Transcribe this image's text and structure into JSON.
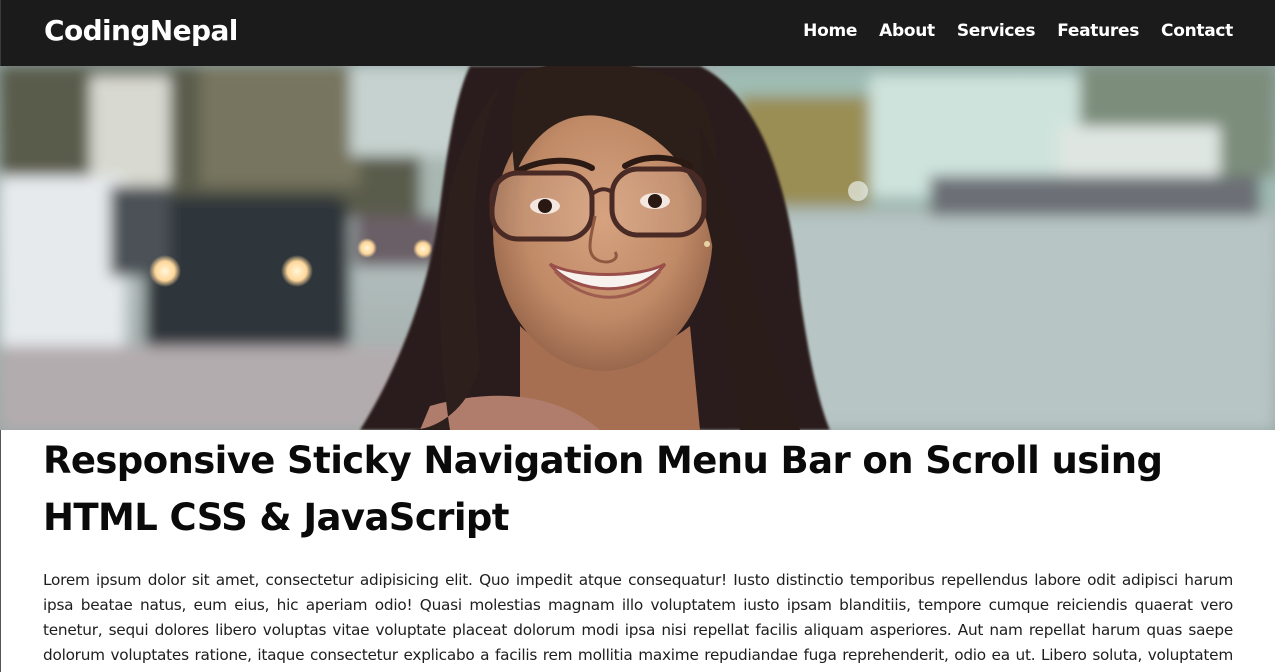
{
  "navbar": {
    "logo": "CodingNepal",
    "links": [
      "Home",
      "About",
      "Services",
      "Features",
      "Contact"
    ]
  },
  "hero": {
    "image": "woman-smiling-glasses-street-photo"
  },
  "article": {
    "title": "Responsive Sticky Navigation Menu Bar on Scroll using HTML CSS & JavaScript",
    "body": "Lorem ipsum dolor sit amet, consectetur adipisicing elit. Quo impedit atque consequatur! Iusto distinctio temporibus repellendus labore odit adipisci harum ipsa beatae natus, eum eius, hic aperiam odio! Quasi molestias magnam illo voluptatem iusto ipsam blanditiis, tempore cumque reiciendis quaerat vero tenetur, sequi dolores libero voluptas vitae voluptate placeat dolorum modi ipsa nisi repellat facilis aliquam asperiores. Aut nam repellat harum quas saepe dolorum voluptates ratione, itaque consectetur explicabo a facilis rem mollitia maxime repudiandae fuga reprehenderit, odio ea ut. Libero soluta, voluptatem quia eum vel odit fugiat distinctio aliquid ea."
  },
  "colors": {
    "navbar_bg": "#1b1b1b",
    "nav_text": "#ffffff",
    "title_text": "#0a0a0a",
    "body_text": "#1e1e1e"
  }
}
